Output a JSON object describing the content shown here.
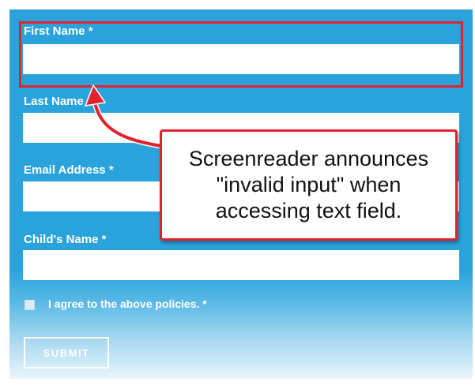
{
  "form": {
    "first_name_label": "First Name *",
    "last_name_label": "Last Name *",
    "email_label": "Email Address *",
    "child_name_label": "Child's Name *",
    "first_name_value": "",
    "last_name_value": "",
    "email_value": "",
    "child_name_value": "",
    "agree_label": "I agree to the above policies. *",
    "agree_checked": false,
    "submit_label": "SUBMIT"
  },
  "annotation": {
    "lines": [
      "Screenreader announces",
      "\"invalid input\" when",
      "accessing text field."
    ],
    "highlight_color": "#e1212d"
  },
  "colors": {
    "form_background": "#2aa3dd",
    "label_text": "#ffffff",
    "annotation_red": "#e1212d"
  },
  "icons": {
    "arrow": "curved-arrow-icon"
  }
}
